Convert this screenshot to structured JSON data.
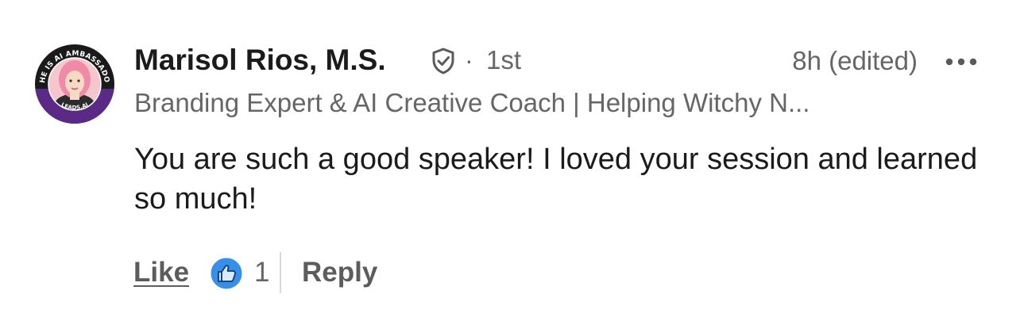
{
  "comment": {
    "author": {
      "name": "Marisol Rios, M.S.",
      "badge_icon": "verified-shield-icon",
      "separator": "·",
      "connection_degree": "1st",
      "headline": "Branding Expert & AI Creative Coach | Helping Witchy N...",
      "avatar": {
        "ring_text_top": "SHE IS AI AMBASSADOR",
        "ring_text_bottom": "LEADS.AI"
      }
    },
    "timestamp": "8h (edited)",
    "more_icon": "more-horizontal-icon",
    "body": "You are such a good speaker! I loved your session and learned so much!",
    "actions": {
      "like_label": "Like",
      "reaction_icon": "like-thumb-icon",
      "reaction_count": "1",
      "reply_label": "Reply"
    }
  },
  "colors": {
    "text_primary": "#1b1b1b",
    "text_secondary": "#666666",
    "action_text": "#5c5c5c",
    "like_blue": "#378fe9",
    "avatar_ring_dark": "#1a1a1a",
    "avatar_ring_purple": "#5b2a86"
  }
}
